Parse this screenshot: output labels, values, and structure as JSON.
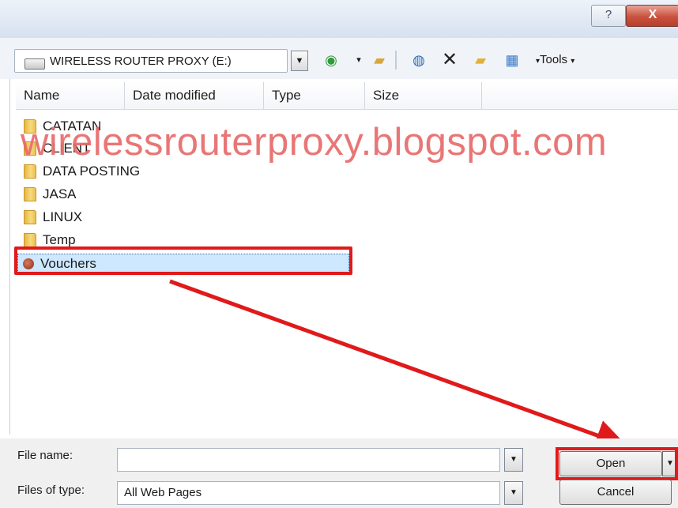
{
  "window": {
    "help_label": "?",
    "close_label": "X"
  },
  "toolbar": {
    "look_in_value": "WIRELESS ROUTER PROXY (E:)",
    "tools_label": "Tools",
    "icons": [
      "back-icon",
      "up-folder-icon",
      "search-web-icon",
      "delete-icon",
      "new-folder-icon",
      "views-icon"
    ]
  },
  "columns": [
    "Name",
    "Date modified",
    "Type",
    "Size"
  ],
  "items": [
    {
      "name": "CATATAN",
      "type": "folder"
    },
    {
      "name": "CLIENT",
      "type": "folder"
    },
    {
      "name": "DATA POSTING",
      "type": "folder"
    },
    {
      "name": "JASA",
      "type": "folder"
    },
    {
      "name": "LINUX",
      "type": "folder"
    },
    {
      "name": "Temp",
      "type": "folder"
    },
    {
      "name": "Vouchers",
      "type": "web-file",
      "selected": true
    }
  ],
  "watermark": "wirelessrouterproxy.blogspot.com",
  "bottom": {
    "file_name_label": "File name:",
    "file_name_value": "",
    "files_of_type_label": "Files of type:",
    "files_of_type_value": "All Web Pages",
    "open_label": "Open",
    "cancel_label": "Cancel"
  },
  "colors": {
    "highlight": "#e01a1a",
    "selection": "#cde8ff",
    "watermark": "#e86b6b"
  }
}
